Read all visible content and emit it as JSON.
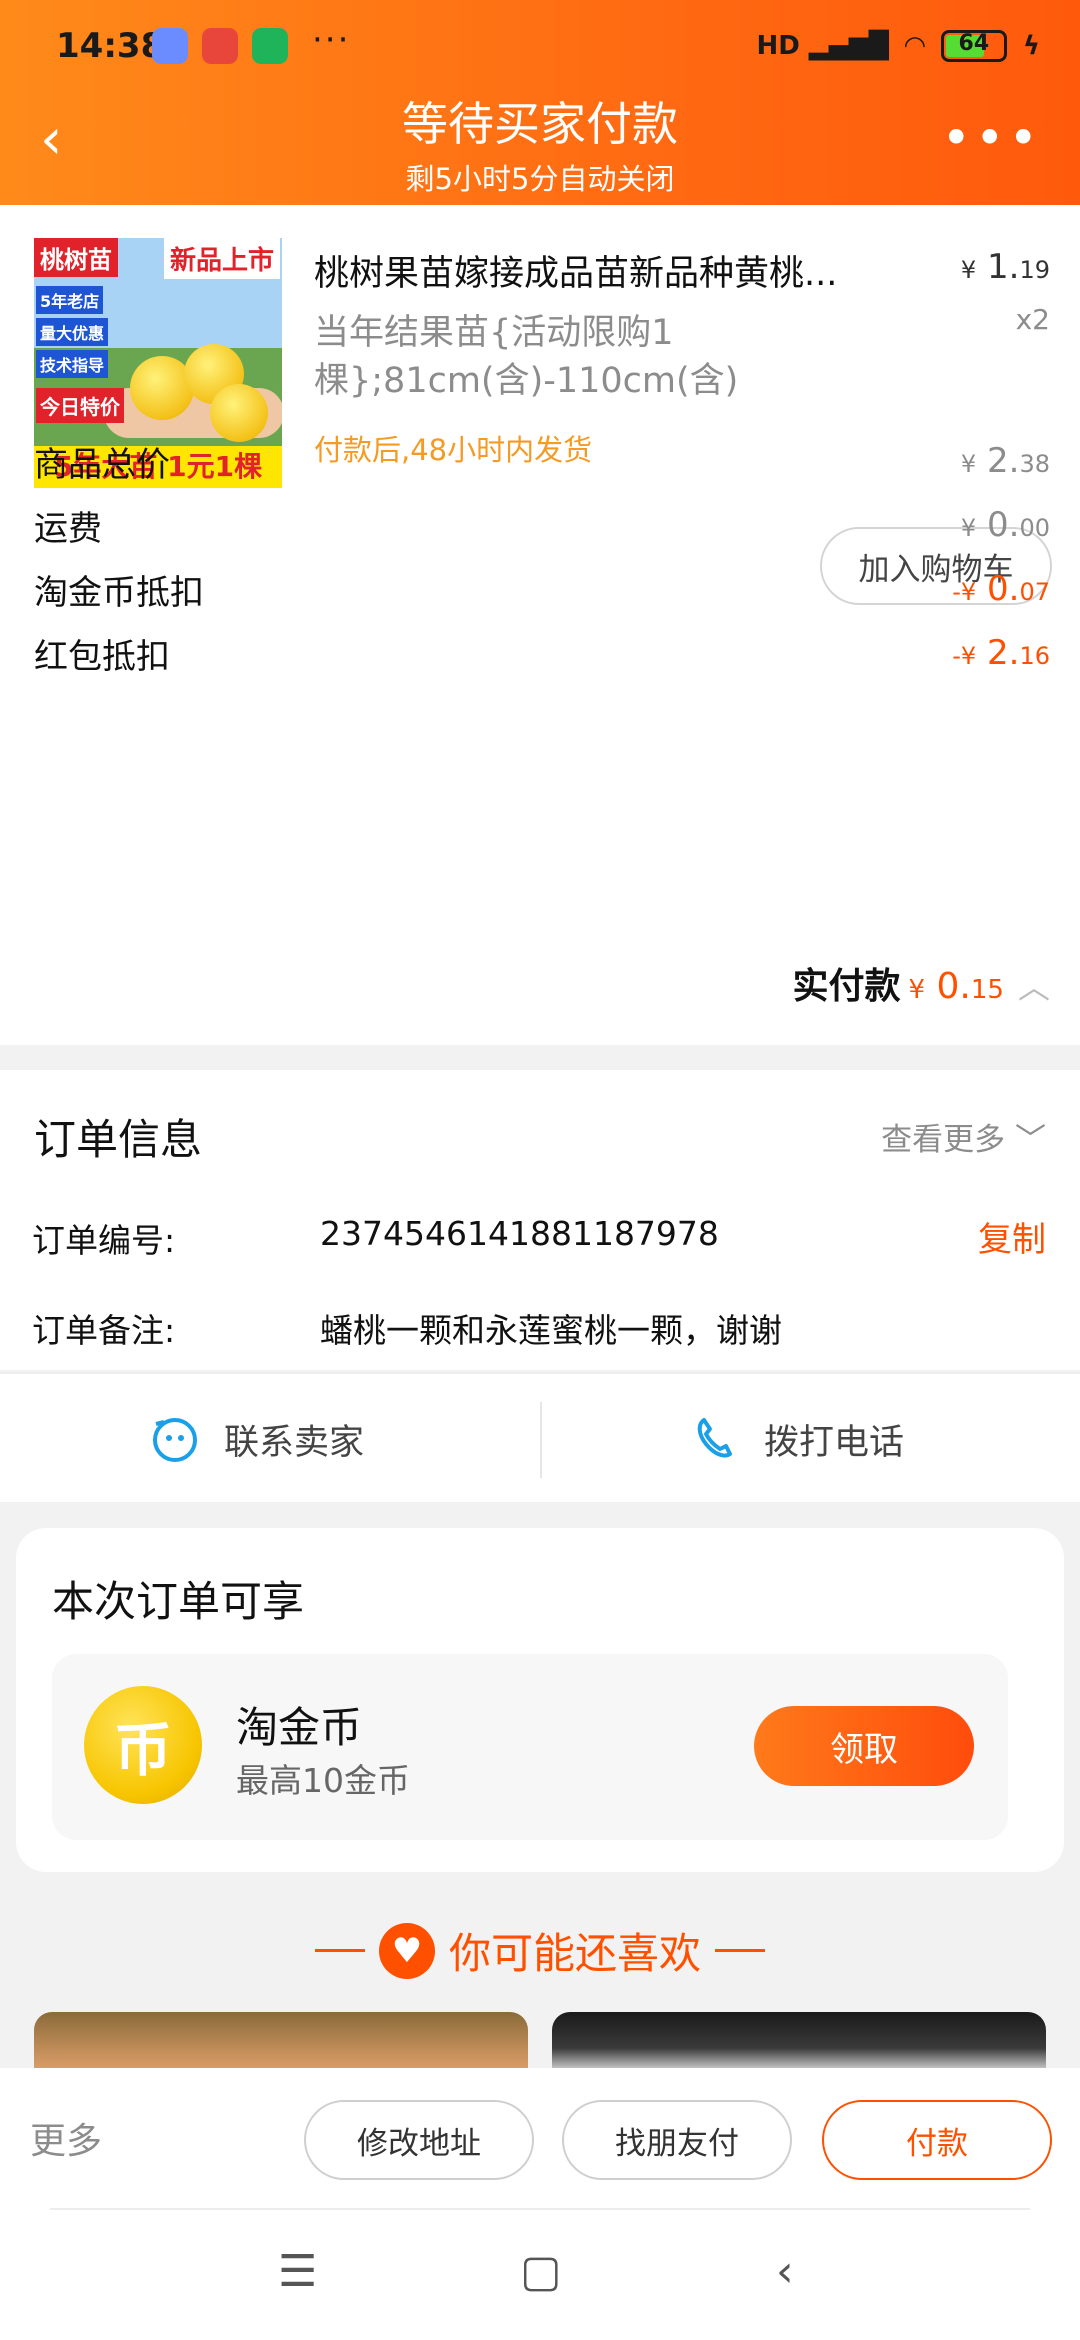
{
  "status_bar": {
    "time": "14:38",
    "dots": "···",
    "signal": "HD",
    "battery": "64"
  },
  "header": {
    "back_icon": "‹",
    "title": "等待买家付款",
    "subtitle": "剩5小时5分自动关闭",
    "more_icon": "•••"
  },
  "product": {
    "thumb": {
      "tag_left": "桃树苗",
      "tag_right": "新品上市",
      "badges": [
        "5年老店",
        "量大优惠",
        "技术指导"
      ],
      "today": "今日特价",
      "bottom": "5年大苗 1元1棵"
    },
    "name": "桃树果苗嫁接成品苗新品种黄桃...",
    "sku": "当年结果苗{活动限购1棵};81cm(含)-110cm(含)",
    "ship_note": "付款后,48小时内发货",
    "price_symbol": "¥",
    "price_int": "1.",
    "price_dec": "19",
    "qty": "x2",
    "add_cart": "加入购物车"
  },
  "summary": [
    {
      "label": "商品总价",
      "sym": "¥",
      "int": "2.",
      "dec": "38"
    },
    {
      "label": "运费",
      "sym": "¥",
      "int": "0.",
      "dec": "00"
    },
    {
      "label": "淘金币抵扣",
      "sym": "-¥",
      "int": "0.",
      "dec": "07"
    },
    {
      "label": "红包抵扣",
      "sym": "-¥",
      "int": "2.",
      "dec": "16"
    }
  ],
  "total": {
    "label": "实付款",
    "sym": "¥",
    "int": "0.",
    "dec": "15",
    "chevron": "︿"
  },
  "order": {
    "title": "订单信息",
    "view_more": "查看更多",
    "no_label": "订单编号:",
    "no_value": "2374546141881187978",
    "copy": "复制",
    "note_label": "订单备注:",
    "note_value": "蟠桃一颗和永莲蜜桃一颗，谢谢"
  },
  "contact": {
    "seller": "联系卖家",
    "phone": "拨打电话"
  },
  "benefit": {
    "title": "本次订单可享",
    "coin_glyph": "币",
    "coin_name": "淘金币",
    "coin_desc": "最高10金币",
    "claim": "领取"
  },
  "recommend": {
    "title": "你可能还喜欢"
  },
  "actions": {
    "more": "更多",
    "change_address": "修改地址",
    "friend_pay": "找朋友付",
    "pay": "付款"
  },
  "nav": {
    "menu": "☰",
    "home": "▢",
    "back": "‹"
  },
  "colors": {
    "accent": "#ff5000",
    "header_start": "#ff8a1a",
    "header_end": "#ff5a0c",
    "ship_note": "#f59a23"
  }
}
